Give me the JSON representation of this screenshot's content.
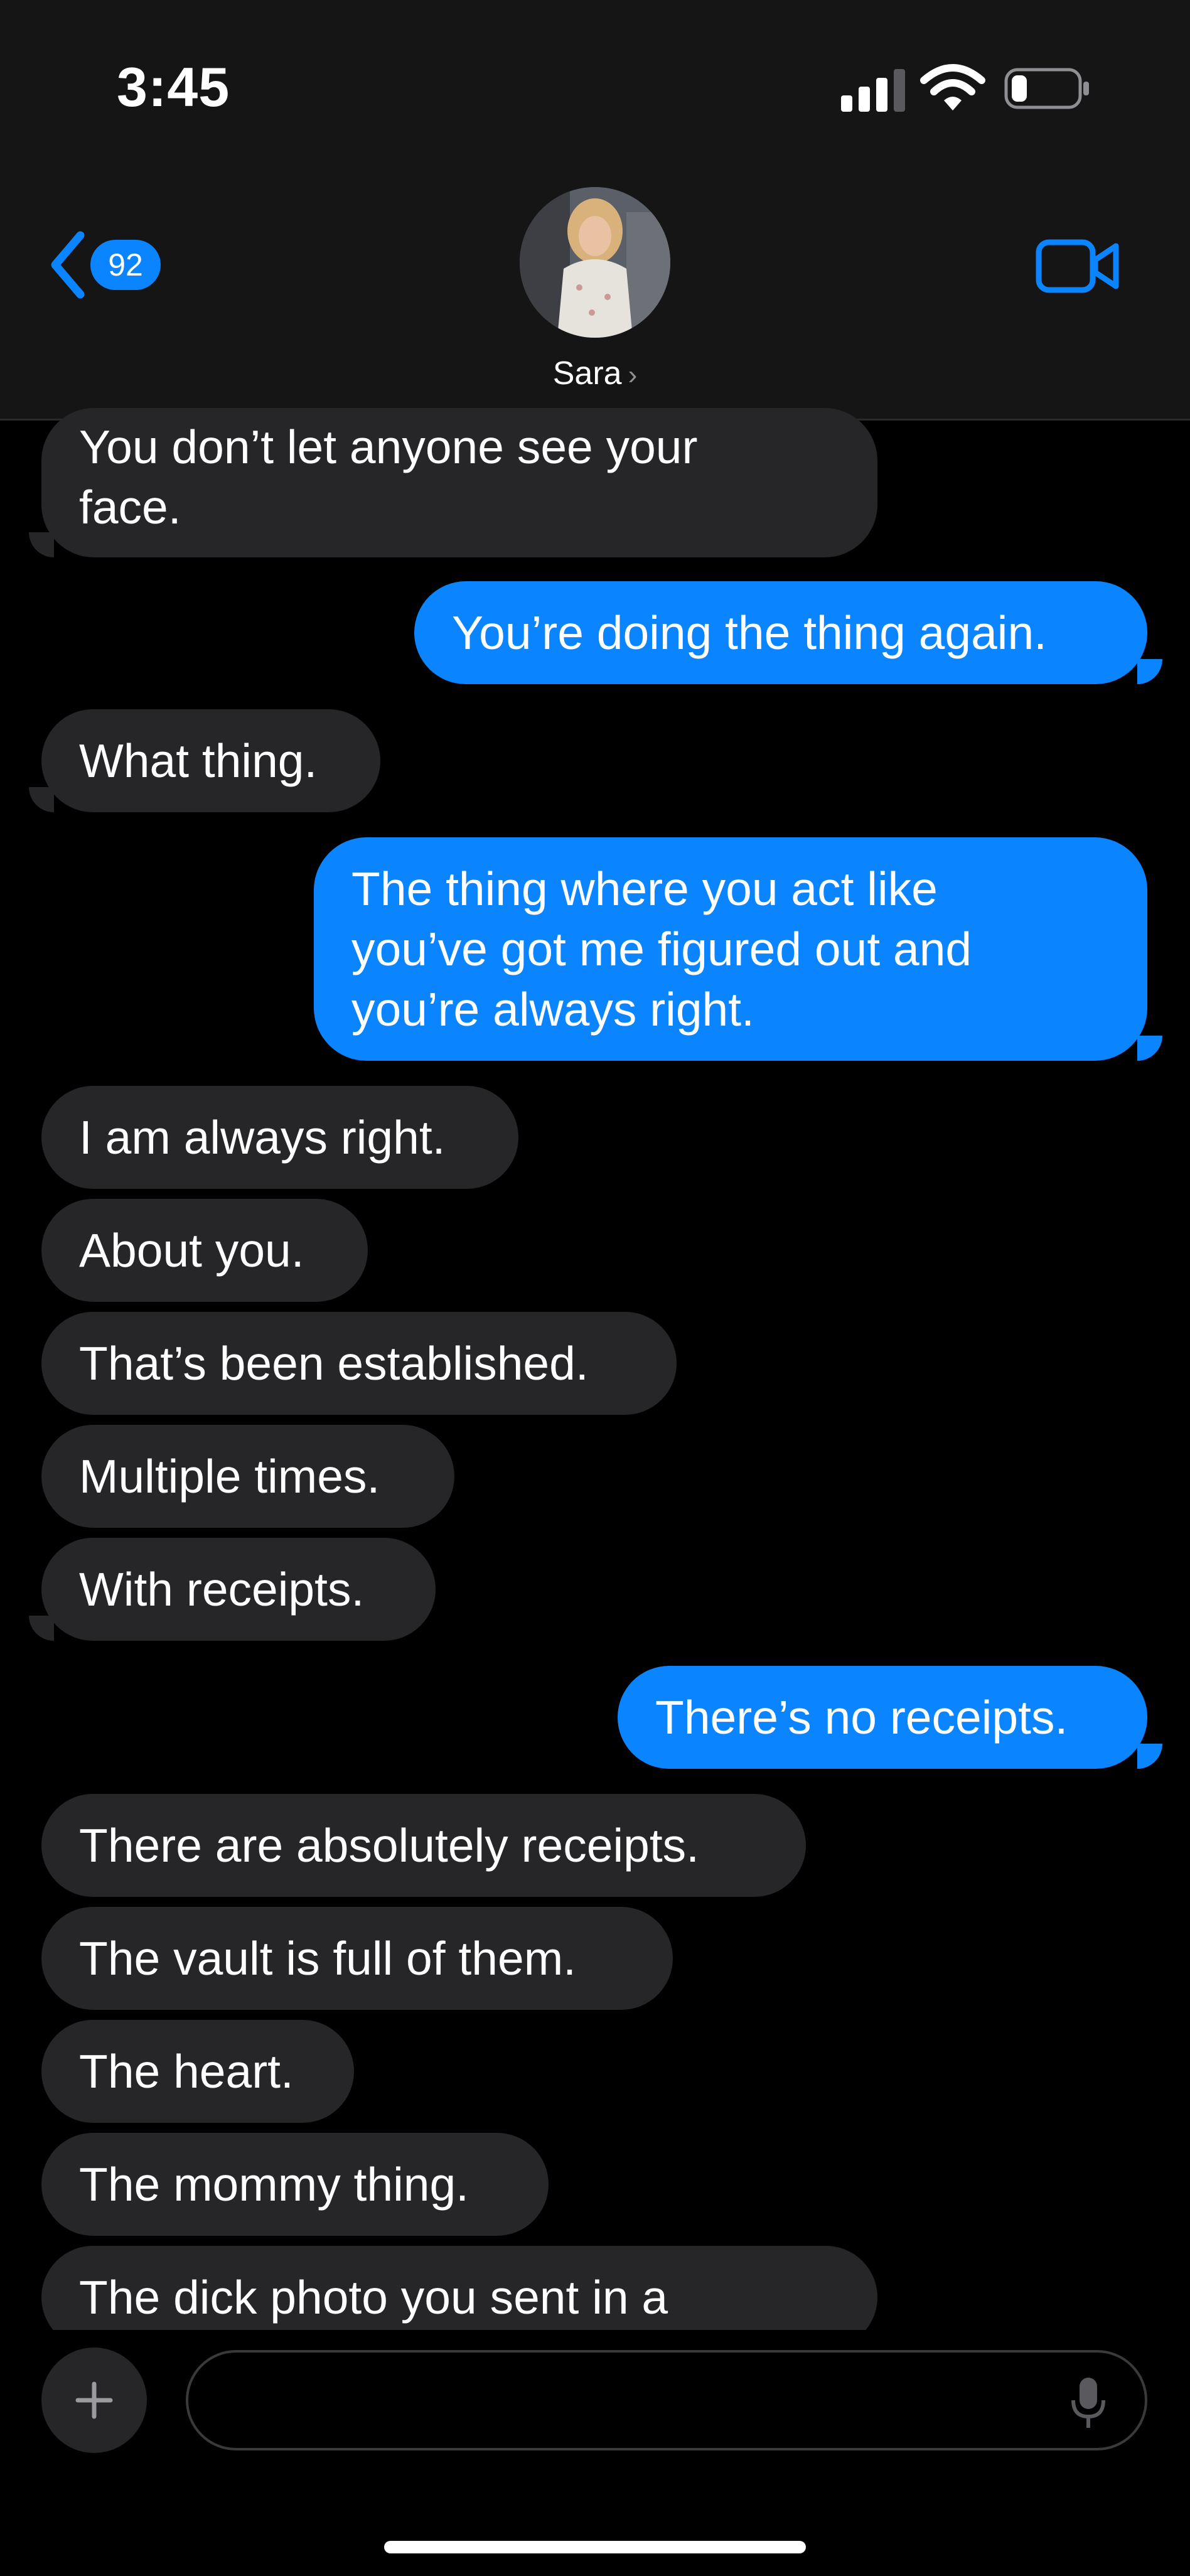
{
  "status_bar": {
    "time": "3:45"
  },
  "header": {
    "back_badge": "92",
    "contact_name": "Sara",
    "contact_chevron": "›"
  },
  "messages": [
    {
      "side": "in",
      "text": "You don’t let anyone see your\nface."
    },
    {
      "side": "out",
      "text": "You’re doing the thing again."
    },
    {
      "side": "in",
      "text": "What thing."
    },
    {
      "side": "out",
      "text": "The thing where you act like\nyou’ve got me figured out and\nyou’re always right."
    },
    {
      "side": "in",
      "text": "I am always right."
    },
    {
      "side": "in",
      "text": "About you."
    },
    {
      "side": "in",
      "text": "That’s been established."
    },
    {
      "side": "in",
      "text": "Multiple times."
    },
    {
      "side": "in",
      "text": "With receipts."
    },
    {
      "side": "out",
      "text": "There’s no receipts."
    },
    {
      "side": "in",
      "text": "There are absolutely receipts."
    },
    {
      "side": "in",
      "text": "The vault is full of them."
    },
    {
      "side": "in",
      "text": "The heart."
    },
    {
      "side": "in",
      "text": "The mommy thing."
    },
    {
      "side": "in",
      "text": "The dick photo you sent in a"
    }
  ],
  "composer": {
    "plus_label": "+",
    "input_value": "",
    "input_placeholder": ""
  },
  "colors": {
    "accent": "#0a84ff",
    "incoming_bubble": "#262628",
    "background": "#000000",
    "header_bg": "#151515"
  },
  "icons": [
    "signal-icon",
    "wifi-icon",
    "battery-icon",
    "back-chevron-icon",
    "video-camera-icon",
    "plus-icon",
    "microphone-icon"
  ]
}
